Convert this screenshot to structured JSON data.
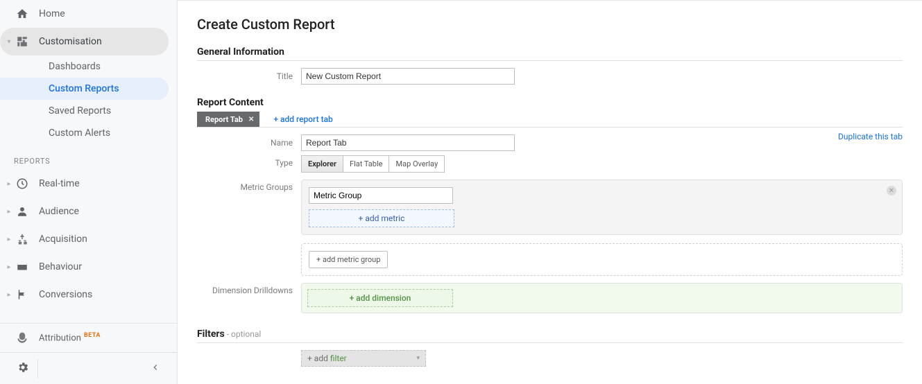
{
  "sidebar": {
    "home": "Home",
    "customisation": "Customisation",
    "subs": {
      "dashboards": "Dashboards",
      "custom_reports": "Custom Reports",
      "saved_reports": "Saved Reports",
      "custom_alerts": "Custom Alerts"
    },
    "reports_label": "REPORTS",
    "realtime": "Real-time",
    "audience": "Audience",
    "acquisition": "Acquisition",
    "behaviour": "Behaviour",
    "conversions": "Conversions",
    "attribution": "Attribution",
    "beta": "BETA"
  },
  "page": {
    "title": "Create Custom Report",
    "general_info": "General Information",
    "title_label": "Title",
    "title_value": "New Custom Report",
    "report_content": "Report Content",
    "report_tab_label": "Report Tab",
    "add_report_tab": "+ add report tab",
    "name_label": "Name",
    "name_value": "Report Tab",
    "duplicate": "Duplicate this tab",
    "type_label": "Type",
    "types": {
      "explorer": "Explorer",
      "flat": "Flat Table",
      "map": "Map Overlay"
    },
    "metric_groups_label": "Metric Groups",
    "metric_group_value": "Metric Group",
    "add_metric": "+ add metric",
    "add_metric_group": "+ add metric group",
    "dimension_label": "Dimension Drilldowns",
    "add_dimension": "+ add dimension",
    "filters": "Filters",
    "filters_optional": " - optional",
    "add_filter_prefix": "+ add ",
    "add_filter_word": "filter"
  }
}
